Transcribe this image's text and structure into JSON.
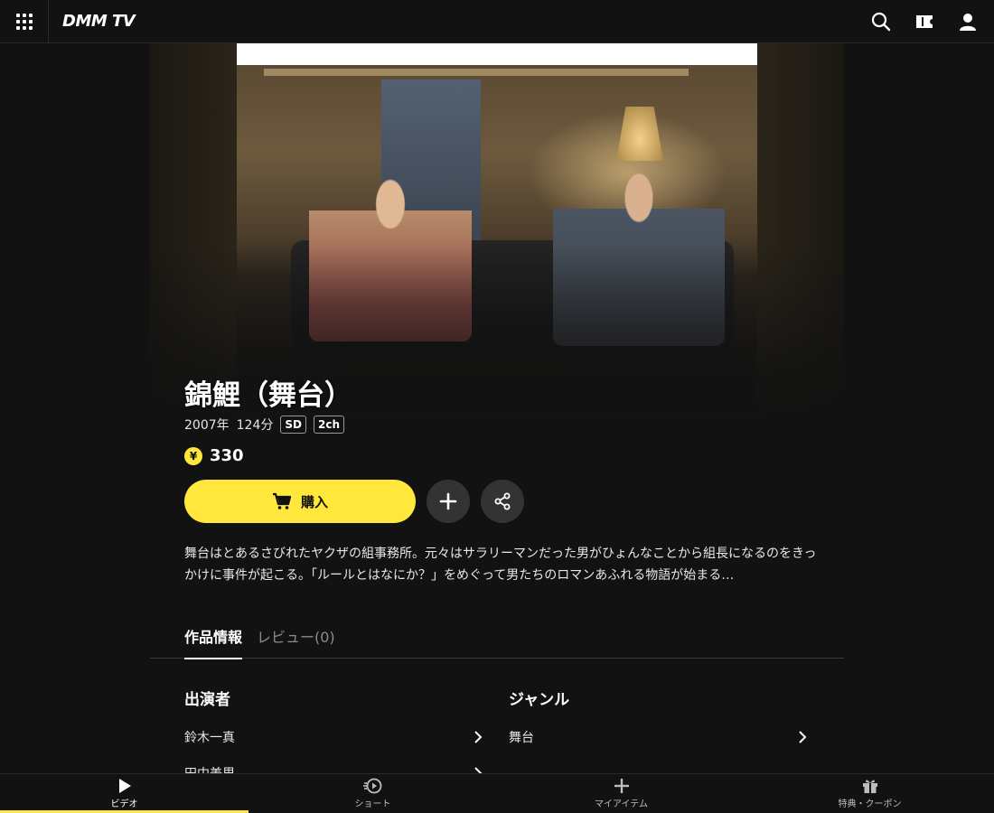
{
  "header": {
    "logo": "DMM TV",
    "icons": [
      "grid-menu-icon",
      "search-icon",
      "ticket-icon",
      "user-icon"
    ]
  },
  "work": {
    "title": "錦鯉（舞台）",
    "year": "2007年",
    "duration": "124分",
    "badges": [
      "SD",
      "2ch"
    ],
    "price_symbol": "¥",
    "price": "330",
    "buy_label": "購入",
    "description": "舞台はとあるさびれたヤクザの組事務所。元々はサラリーマンだった男がひょんなことから組長になるのをきっかけに事件が起こる。「ルールとはなにか？」をめぐって男たちのロマンあふれる物語が始まる…"
  },
  "tabs": [
    {
      "label": "作品情報",
      "active": true
    },
    {
      "label": "レビュー(0)",
      "active": false
    }
  ],
  "info": {
    "cast_title": "出演者",
    "cast": [
      "鈴木一真",
      "田中美里"
    ],
    "genre_title": "ジャンル",
    "genres": [
      "舞台"
    ]
  },
  "bottom_nav": [
    {
      "label": "ビデオ",
      "icon": "play-icon",
      "active": true
    },
    {
      "label": "ショート",
      "icon": "short-play-icon",
      "active": false
    },
    {
      "label": "マイアイテム",
      "icon": "plus-icon",
      "active": false
    },
    {
      "label": "特典・クーポン",
      "icon": "gift-icon",
      "active": false
    }
  ],
  "colors": {
    "accent": "#ffe73b",
    "background": "#121212",
    "button_gray": "#333333"
  }
}
